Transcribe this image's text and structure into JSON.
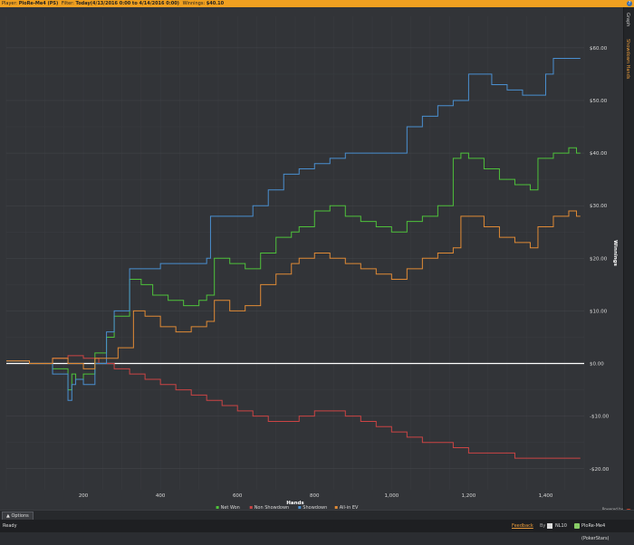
{
  "topbar": {
    "player_label": "Player:",
    "player_value": "PloRe-Me4 (PS)",
    "filter_label": "Filter:",
    "filter_value": "Today(4/13/2016 0:00 to 4/14/2016 0:00)",
    "winnings_label": "Winnings:",
    "winnings_value": "$40.10"
  },
  "right_tabs": {
    "graph": "Graph",
    "showdown_hands": "Showdown Hands"
  },
  "options": {
    "label": "Options"
  },
  "statusbar": {
    "ready": "Ready",
    "feedback": "Feedback",
    "by": "By",
    "limit": "NL10",
    "player": "PloRe-Me4 (PokerStars)"
  },
  "logo": {
    "powered": "Powered by",
    "name": "Hold'em Manager",
    "badge": "2"
  },
  "colors": {
    "net_won": "#4ec23a",
    "non_showdown": "#cc4444",
    "showdown": "#4a8fd0",
    "all_in_ev": "#e08a35",
    "background": "#323438",
    "grid": "#45474c"
  },
  "chart_data": {
    "type": "line",
    "xlabel": "Hands",
    "ylabel": "Winnings",
    "xlim": [
      0,
      1500
    ],
    "ylim": [
      -24,
      66
    ],
    "x_ticks": [
      200,
      400,
      600,
      800,
      1000,
      1200,
      1400
    ],
    "x_tick_labels": [
      "200",
      "400",
      "600",
      "800",
      "1,000",
      "1,200",
      "1,400"
    ],
    "y_ticks": [
      60,
      50,
      40,
      30,
      20,
      10,
      0,
      -10,
      -20
    ],
    "y_tick_labels": [
      "$60.00",
      "$50.00",
      "$40.00",
      "$30.00",
      "$20.00",
      "$10.00",
      "$0.00",
      "-$10.00",
      "-$20.00"
    ],
    "legend_position": "bottom-center",
    "series": [
      {
        "name": "Net Won",
        "color": "#4ec23a",
        "x": [
          0,
          60,
          120,
          160,
          170,
          180,
          200,
          230,
          260,
          280,
          310,
          320,
          350,
          380,
          420,
          460,
          500,
          520,
          540,
          580,
          620,
          660,
          700,
          740,
          760,
          800,
          840,
          880,
          920,
          960,
          1000,
          1040,
          1080,
          1120,
          1160,
          1180,
          1200,
          1240,
          1280,
          1320,
          1360,
          1380,
          1420,
          1460,
          1480,
          1490
        ],
        "y": [
          0.5,
          0,
          -1,
          -5,
          -2,
          -3,
          -2,
          2,
          5,
          9,
          9,
          16,
          15,
          13,
          12,
          11,
          12,
          13,
          20,
          19,
          18,
          21,
          24,
          25,
          26,
          29,
          30,
          28,
          27,
          26,
          25,
          27,
          28,
          30,
          39,
          40,
          39,
          37,
          35,
          34,
          33,
          39,
          40,
          41,
          40,
          40
        ]
      },
      {
        "name": "Non Showdown",
        "color": "#cc4444",
        "x": [
          0,
          60,
          120,
          160,
          200,
          240,
          280,
          320,
          360,
          400,
          440,
          480,
          520,
          560,
          600,
          640,
          680,
          720,
          760,
          800,
          840,
          880,
          920,
          960,
          1000,
          1040,
          1080,
          1120,
          1160,
          1200,
          1240,
          1280,
          1320,
          1360,
          1400,
          1440,
          1480,
          1490
        ],
        "y": [
          0.5,
          0,
          1,
          1.5,
          1,
          0,
          -1,
          -2,
          -3,
          -4,
          -5,
          -6,
          -7,
          -8,
          -9,
          -10,
          -11,
          -11,
          -10,
          -9,
          -9,
          -10,
          -11,
          -12,
          -13,
          -14,
          -15,
          -15,
          -16,
          -17,
          -17,
          -17,
          -18,
          -18,
          -18,
          -18,
          -18,
          -18
        ]
      },
      {
        "name": "Showdown",
        "color": "#4a8fd0",
        "x": [
          0,
          60,
          120,
          160,
          170,
          180,
          200,
          230,
          260,
          280,
          310,
          320,
          360,
          400,
          440,
          480,
          520,
          530,
          560,
          600,
          640,
          680,
          720,
          760,
          800,
          840,
          880,
          920,
          960,
          1000,
          1040,
          1080,
          1120,
          1160,
          1200,
          1240,
          1260,
          1300,
          1340,
          1380,
          1400,
          1420,
          1460,
          1490
        ],
        "y": [
          0.5,
          0,
          -2,
          -7,
          -4,
          -3,
          -4,
          0,
          6,
          10,
          10,
          18,
          18,
          19,
          19,
          19,
          20,
          28,
          28,
          28,
          30,
          33,
          36,
          37,
          38,
          39,
          40,
          40,
          40,
          40,
          45,
          47,
          49,
          50,
          55,
          55,
          53,
          52,
          51,
          51,
          55,
          58,
          58,
          58
        ]
      },
      {
        "name": "All-in EV",
        "color": "#e08a35",
        "x": [
          0,
          60,
          120,
          160,
          200,
          230,
          260,
          290,
          310,
          330,
          360,
          400,
          440,
          480,
          520,
          540,
          580,
          620,
          660,
          700,
          740,
          760,
          800,
          840,
          880,
          920,
          960,
          1000,
          1040,
          1080,
          1120,
          1160,
          1180,
          1200,
          1240,
          1280,
          1320,
          1360,
          1380,
          1420,
          1460,
          1480,
          1490
        ],
        "y": [
          0.5,
          0,
          1,
          0,
          -1,
          1,
          1,
          3,
          3,
          10,
          9,
          7,
          6,
          7,
          8,
          12,
          10,
          11,
          15,
          17,
          19,
          20,
          21,
          20,
          19,
          18,
          17,
          16,
          18,
          20,
          21,
          22,
          28,
          28,
          26,
          24,
          23,
          22,
          26,
          28,
          29,
          28,
          28
        ]
      }
    ]
  }
}
